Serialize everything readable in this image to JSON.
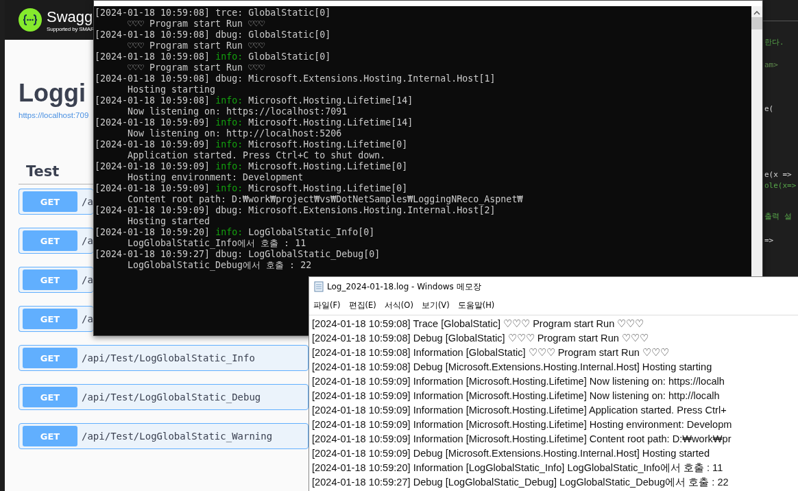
{
  "swagger": {
    "brand": "Swagg",
    "brand_sub": "Supported by SMAR",
    "title": "Loggi",
    "url": "https://localhost:709",
    "section": "Test",
    "operations": [
      {
        "method": "GET",
        "path": "/a"
      },
      {
        "method": "GET",
        "path": "/a"
      },
      {
        "method": "GET",
        "path": "/a"
      },
      {
        "method": "GET",
        "path": "/a"
      },
      {
        "method": "GET",
        "path": "/api/Test/LogGlobalStatic_Info"
      },
      {
        "method": "GET",
        "path": "/api/Test/LogGlobalStatic_Debug"
      },
      {
        "method": "GET",
        "path": "/api/Test/LogGlobalStatic_Warning"
      }
    ]
  },
  "editor": {
    "fragments": [
      {
        "text": "한다.",
        "kind": "comment"
      },
      {
        "text": "am>",
        "kind": "tag"
      },
      {
        "text": "e(",
        "kind": "code"
      },
      {
        "text": "e(x =>",
        "kind": "code"
      },
      {
        "text": "ole(x=>",
        "kind": "comment"
      },
      {
        "text": "출력 설",
        "kind": "comment"
      },
      {
        "text": "=>",
        "kind": "code"
      }
    ]
  },
  "console": {
    "entries": [
      {
        "timestamp": "[2024-01-18 10:59:08]",
        "level": "trce:",
        "highlighted": false,
        "category": "GlobalStatic[0]",
        "message": "♡♡♡ Program start Run ♡♡♡"
      },
      {
        "timestamp": "[2024-01-18 10:59:08]",
        "level": "dbug:",
        "highlighted": false,
        "category": "GlobalStatic[0]",
        "message": "♡♡♡ Program start Run ♡♡♡"
      },
      {
        "timestamp": "[2024-01-18 10:59:08]",
        "level": "info:",
        "highlighted": true,
        "category": "GlobalStatic[0]",
        "message": "♡♡♡ Program start Run ♡♡♡"
      },
      {
        "timestamp": "[2024-01-18 10:59:08]",
        "level": "dbug:",
        "highlighted": false,
        "category": "Microsoft.Extensions.Hosting.Internal.Host[1]",
        "message": "Hosting starting"
      },
      {
        "timestamp": "[2024-01-18 10:59:08]",
        "level": "info:",
        "highlighted": true,
        "category": "Microsoft.Hosting.Lifetime[14]",
        "message": "Now listening on: https://localhost:7091"
      },
      {
        "timestamp": "[2024-01-18 10:59:09]",
        "level": "info:",
        "highlighted": true,
        "category": "Microsoft.Hosting.Lifetime[14]",
        "message": "Now listening on: http://localhost:5206"
      },
      {
        "timestamp": "[2024-01-18 10:59:09]",
        "level": "info:",
        "highlighted": true,
        "category": "Microsoft.Hosting.Lifetime[0]",
        "message": "Application started. Press Ctrl+C to shut down."
      },
      {
        "timestamp": "[2024-01-18 10:59:09]",
        "level": "info:",
        "highlighted": true,
        "category": "Microsoft.Hosting.Lifetime[0]",
        "message": "Hosting environment: Development"
      },
      {
        "timestamp": "[2024-01-18 10:59:09]",
        "level": "info:",
        "highlighted": true,
        "category": "Microsoft.Hosting.Lifetime[0]",
        "message": "Content root path: D:₩work₩project₩vs₩DotNetSamples₩LoggingNReco_Aspnet₩"
      },
      {
        "timestamp": "[2024-01-18 10:59:09]",
        "level": "dbug:",
        "highlighted": false,
        "category": "Microsoft.Extensions.Hosting.Internal.Host[2]",
        "message": "Hosting started"
      },
      {
        "timestamp": "[2024-01-18 10:59:20]",
        "level": "info:",
        "highlighted": true,
        "category": "LogGlobalStatic_Info[0]",
        "message": "LogGlobalStatic_Info에서 호출 : 11"
      },
      {
        "timestamp": "[2024-01-18 10:59:27]",
        "level": "dbug:",
        "highlighted": false,
        "category": "LogGlobalStatic_Debug[0]",
        "message": "LogGlobalStatic_Debug에서 호출 : 22"
      }
    ]
  },
  "notepad": {
    "title": "Log_2024-01-18.log - Windows 메모장",
    "menu": [
      "파일(F)",
      "편집(E)",
      "서식(O)",
      "보기(V)",
      "도움말(H)"
    ],
    "lines": [
      "[2024-01-18 10:59:08] Trace [GlobalStatic] ♡♡♡ Program start Run ♡♡♡",
      "[2024-01-18 10:59:08] Debug [GlobalStatic] ♡♡♡ Program start Run ♡♡♡",
      "[2024-01-18 10:59:08] Information [GlobalStatic] ♡♡♡ Program start Run ♡♡♡",
      "[2024-01-18 10:59:08] Debug [Microsoft.Extensions.Hosting.Internal.Host] Hosting starting",
      "[2024-01-18 10:59:09] Information [Microsoft.Hosting.Lifetime] Now listening on: https://localh",
      "[2024-01-18 10:59:09] Information [Microsoft.Hosting.Lifetime] Now listening on: http://localh",
      "[2024-01-18 10:59:09] Information [Microsoft.Hosting.Lifetime] Application started. Press Ctrl+",
      "[2024-01-18 10:59:09] Information [Microsoft.Hosting.Lifetime] Hosting environment: Developm",
      "[2024-01-18 10:59:09] Information [Microsoft.Hosting.Lifetime] Content root path: D:₩work₩pr",
      "[2024-01-18 10:59:09] Debug [Microsoft.Extensions.Hosting.Internal.Host] Hosting started",
      "[2024-01-18 10:59:20] Information [LogGlobalStatic_Info] LogGlobalStatic_Info에서 호출 : 11",
      "[2024-01-18 10:59:27] Debug [LogGlobalStatic_Debug] LogGlobalStatic_Debug에서 호출 : 22"
    ]
  }
}
